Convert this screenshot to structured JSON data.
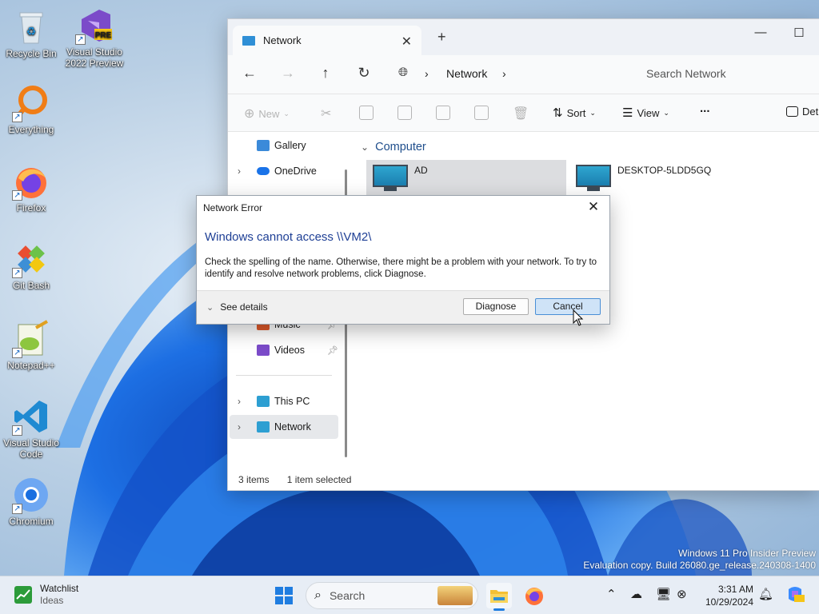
{
  "desktop": {
    "icons": [
      {
        "label": "Recycle Bin"
      },
      {
        "label": "Visual Studio 2022 Preview",
        "badge": "PRE"
      },
      {
        "label": "Everything"
      },
      {
        "label": "Firefox"
      },
      {
        "label": "Git Bash"
      },
      {
        "label": "Notepad++"
      },
      {
        "label": "Visual Studio Code"
      },
      {
        "label": "Chromium"
      }
    ],
    "watermark_line1": "Windows 11 Pro Insider Preview",
    "watermark_line2": "Evaluation copy. Build 26080.ge_release.240308-1400"
  },
  "explorer": {
    "tab_title": "Network",
    "address_crumb": "Network",
    "search_placeholder": "Search Network",
    "toolbar": {
      "new_label": "New",
      "sort_label": "Sort",
      "view_label": "View",
      "more_label": "...",
      "details_label": "Det"
    },
    "sidebar": {
      "items": [
        {
          "label": "Gallery"
        },
        {
          "label": "OneDrive"
        },
        {
          "label": "Music"
        },
        {
          "label": "Videos"
        },
        {
          "label": "This PC"
        },
        {
          "label": "Network"
        }
      ]
    },
    "content": {
      "group_header": "Computer",
      "items": [
        {
          "label": "AD"
        },
        {
          "label": "DESKTOP-5LDD5GQ"
        }
      ]
    },
    "status": {
      "count": "3 items",
      "selected": "1 item selected"
    }
  },
  "dialog": {
    "title": "Network Error",
    "main_instruction": "Windows cannot access \\\\VM2\\",
    "body": "Check the spelling of the name. Otherwise, there might be a problem with your network. To try to identify and resolve network problems, click Diagnose.",
    "see_details": "See details",
    "diagnose_label": "Diagnose",
    "cancel_label": "Cancel"
  },
  "taskbar": {
    "widget_title": "Watchlist",
    "widget_subtitle": "Ideas",
    "search_placeholder": "Search",
    "time": "3:31 AM",
    "date": "10/29/2024"
  }
}
